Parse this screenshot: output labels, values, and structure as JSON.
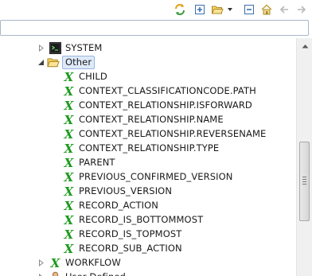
{
  "toolbar": {
    "buttons": [
      {
        "name": "sync-icon"
      },
      {
        "name": "new-icon"
      },
      {
        "name": "open-folder-icon"
      },
      {
        "name": "dropdown-arrow-icon"
      },
      {
        "name": "collapse-all-icon"
      },
      {
        "name": "home-icon"
      },
      {
        "name": "back-arrow-icon"
      },
      {
        "name": "forward-arrow-icon"
      }
    ]
  },
  "search": {
    "value": "",
    "placeholder": ""
  },
  "tree": {
    "system": {
      "label": "SYSTEM",
      "expanded": false,
      "icon": "console-icon"
    },
    "other": {
      "label": "Other",
      "expanded": true,
      "selected": true,
      "icon": "folder-open-icon",
      "children": [
        "CHILD",
        "CONTEXT_CLASSIFICATIONCODE.PATH",
        "CONTEXT_RELATIONSHIP.ISFORWARD",
        "CONTEXT_RELATIONSHIP.NAME",
        "CONTEXT_RELATIONSHIP.REVERSENAME",
        "CONTEXT_RELATIONSHIP.TYPE",
        "PARENT",
        "PREVIOUS_CONFIRMED_VERSION",
        "PREVIOUS_VERSION",
        "RECORD_ACTION",
        "RECORD_IS_BOTTOMMOST",
        "RECORD_IS_TOPMOST",
        "RECORD_SUB_ACTION"
      ],
      "child_icon": "variable-x-icon"
    },
    "workflow": {
      "label": "WORKFLOW",
      "expanded": false,
      "icon": "variable-x-icon"
    },
    "user_defined": {
      "label": "User Defined",
      "expanded": false,
      "icon": "user-icon"
    }
  },
  "colors": {
    "x_icon": "#1f9a1f",
    "selection_bg": "#dfeaf9",
    "selection_border": "#97b4e1"
  }
}
